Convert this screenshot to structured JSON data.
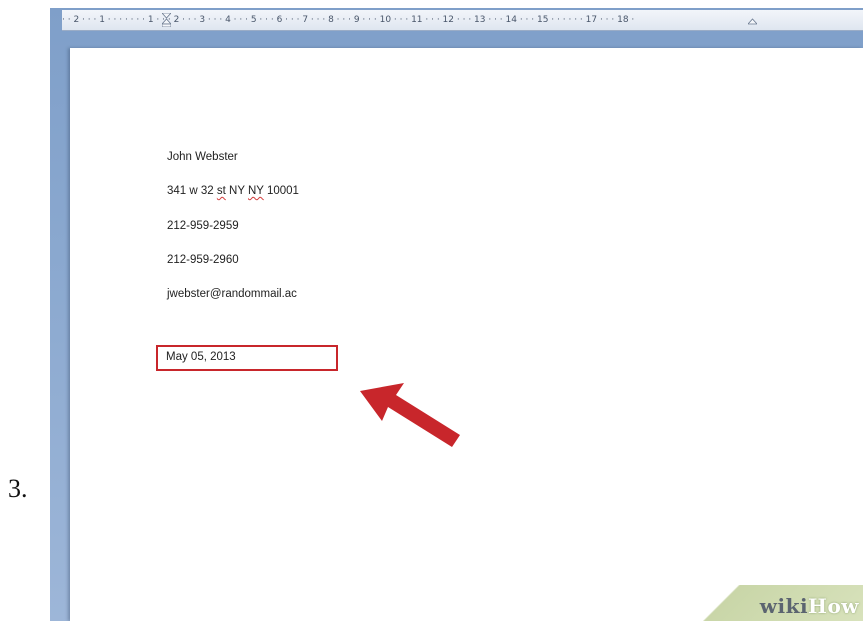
{
  "step": {
    "number": "3."
  },
  "ruler": {
    "ticks": "· · 2 · · · 1 · · · ·   · · · 1 · · · 2 · · · 3 · · · 4 · · · 5 · · · 6 · · · 7 · · · 8 · · · 9 · · · 10 · · · 11 · · · 12 · · · 13 · · · 14 · · · 15 · · ·   · · · 17 · · · 18 ·"
  },
  "document": {
    "lines": {
      "name": "John Webster",
      "address_pre": "341 w 32 ",
      "address_st": "st",
      "address_mid": " NY ",
      "address_ny": "NY",
      "address_post": " 10001",
      "phone": "212-959-2959",
      "fax": "212-959-2960",
      "email": "jwebster@randommail.ac"
    },
    "date": "May 05, 2013"
  },
  "annotation": {
    "box_color": "#c8262b",
    "arrow_color": "#c8262b",
    "arrow_icon": "arrow-up-left-icon"
  },
  "watermark": {
    "wiki": "wiki",
    "how": "How"
  },
  "colors": {
    "window": "#8aa8cf",
    "ruler": "#e8edf5",
    "page": "#ffffff",
    "misspell": "#d23a3a"
  }
}
